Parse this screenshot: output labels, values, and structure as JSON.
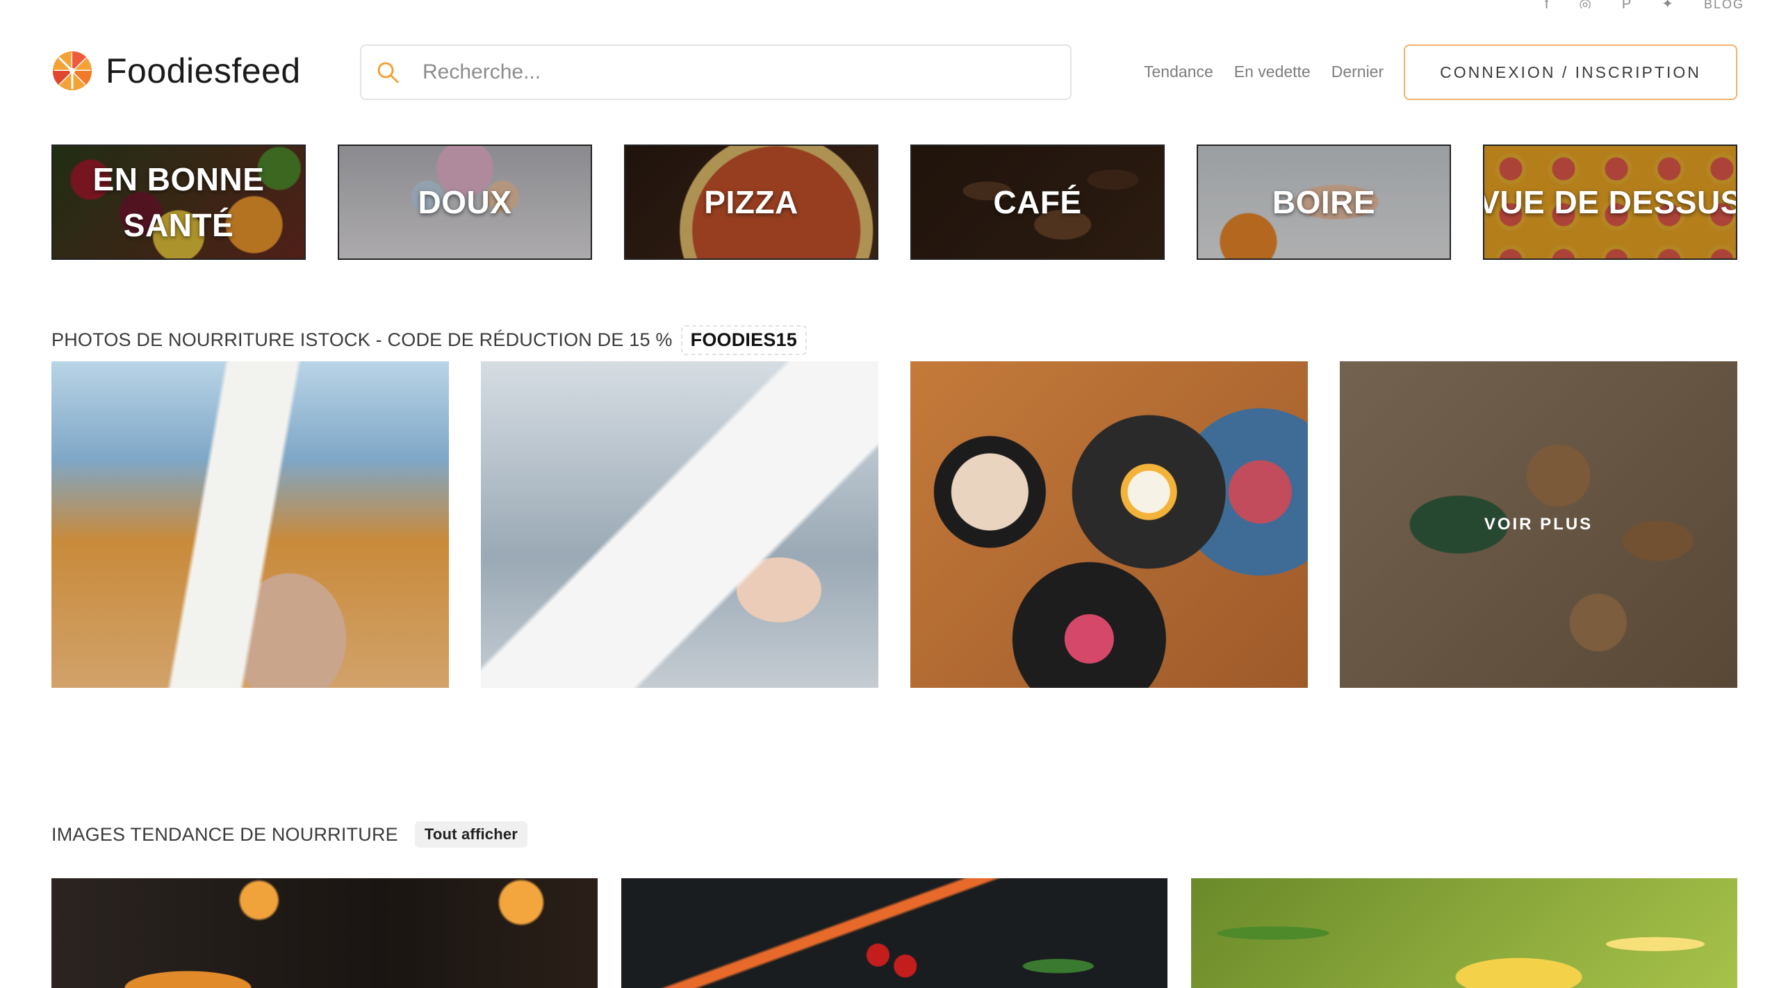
{
  "social": {
    "icons": [
      "facebook-icon",
      "instagram-icon",
      "pinterest-icon",
      "twitter-icon"
    ],
    "blog_label": "BLOG"
  },
  "header": {
    "brand": "Foodiesfeed",
    "search_placeholder": "Recherche...",
    "nav": [
      "Tendance",
      "En vedette",
      "Dernier"
    ],
    "login_label": "CONNEXION / INSCRIPTION"
  },
  "categories": [
    {
      "label": "EN BONNE SANTÉ"
    },
    {
      "label": "DOUX"
    },
    {
      "label": "PIZZA"
    },
    {
      "label": "CAFÉ"
    },
    {
      "label": "BOIRE"
    },
    {
      "label": "VUE DE DESSUS"
    }
  ],
  "istock": {
    "title": "PHOTOS DE NOURRITURE ISTOCK - CODE DE RÉDUCTION DE 15 %",
    "code": "FOODIES15",
    "see_more": "VOIR PLUS"
  },
  "trending": {
    "title": "IMAGES TENDANCE DE NOURRITURE",
    "view_all": "Tout afficher"
  },
  "colors": {
    "accent": "#f2b36a",
    "text": "#1e1e1e",
    "muted": "#7d7d7d"
  }
}
